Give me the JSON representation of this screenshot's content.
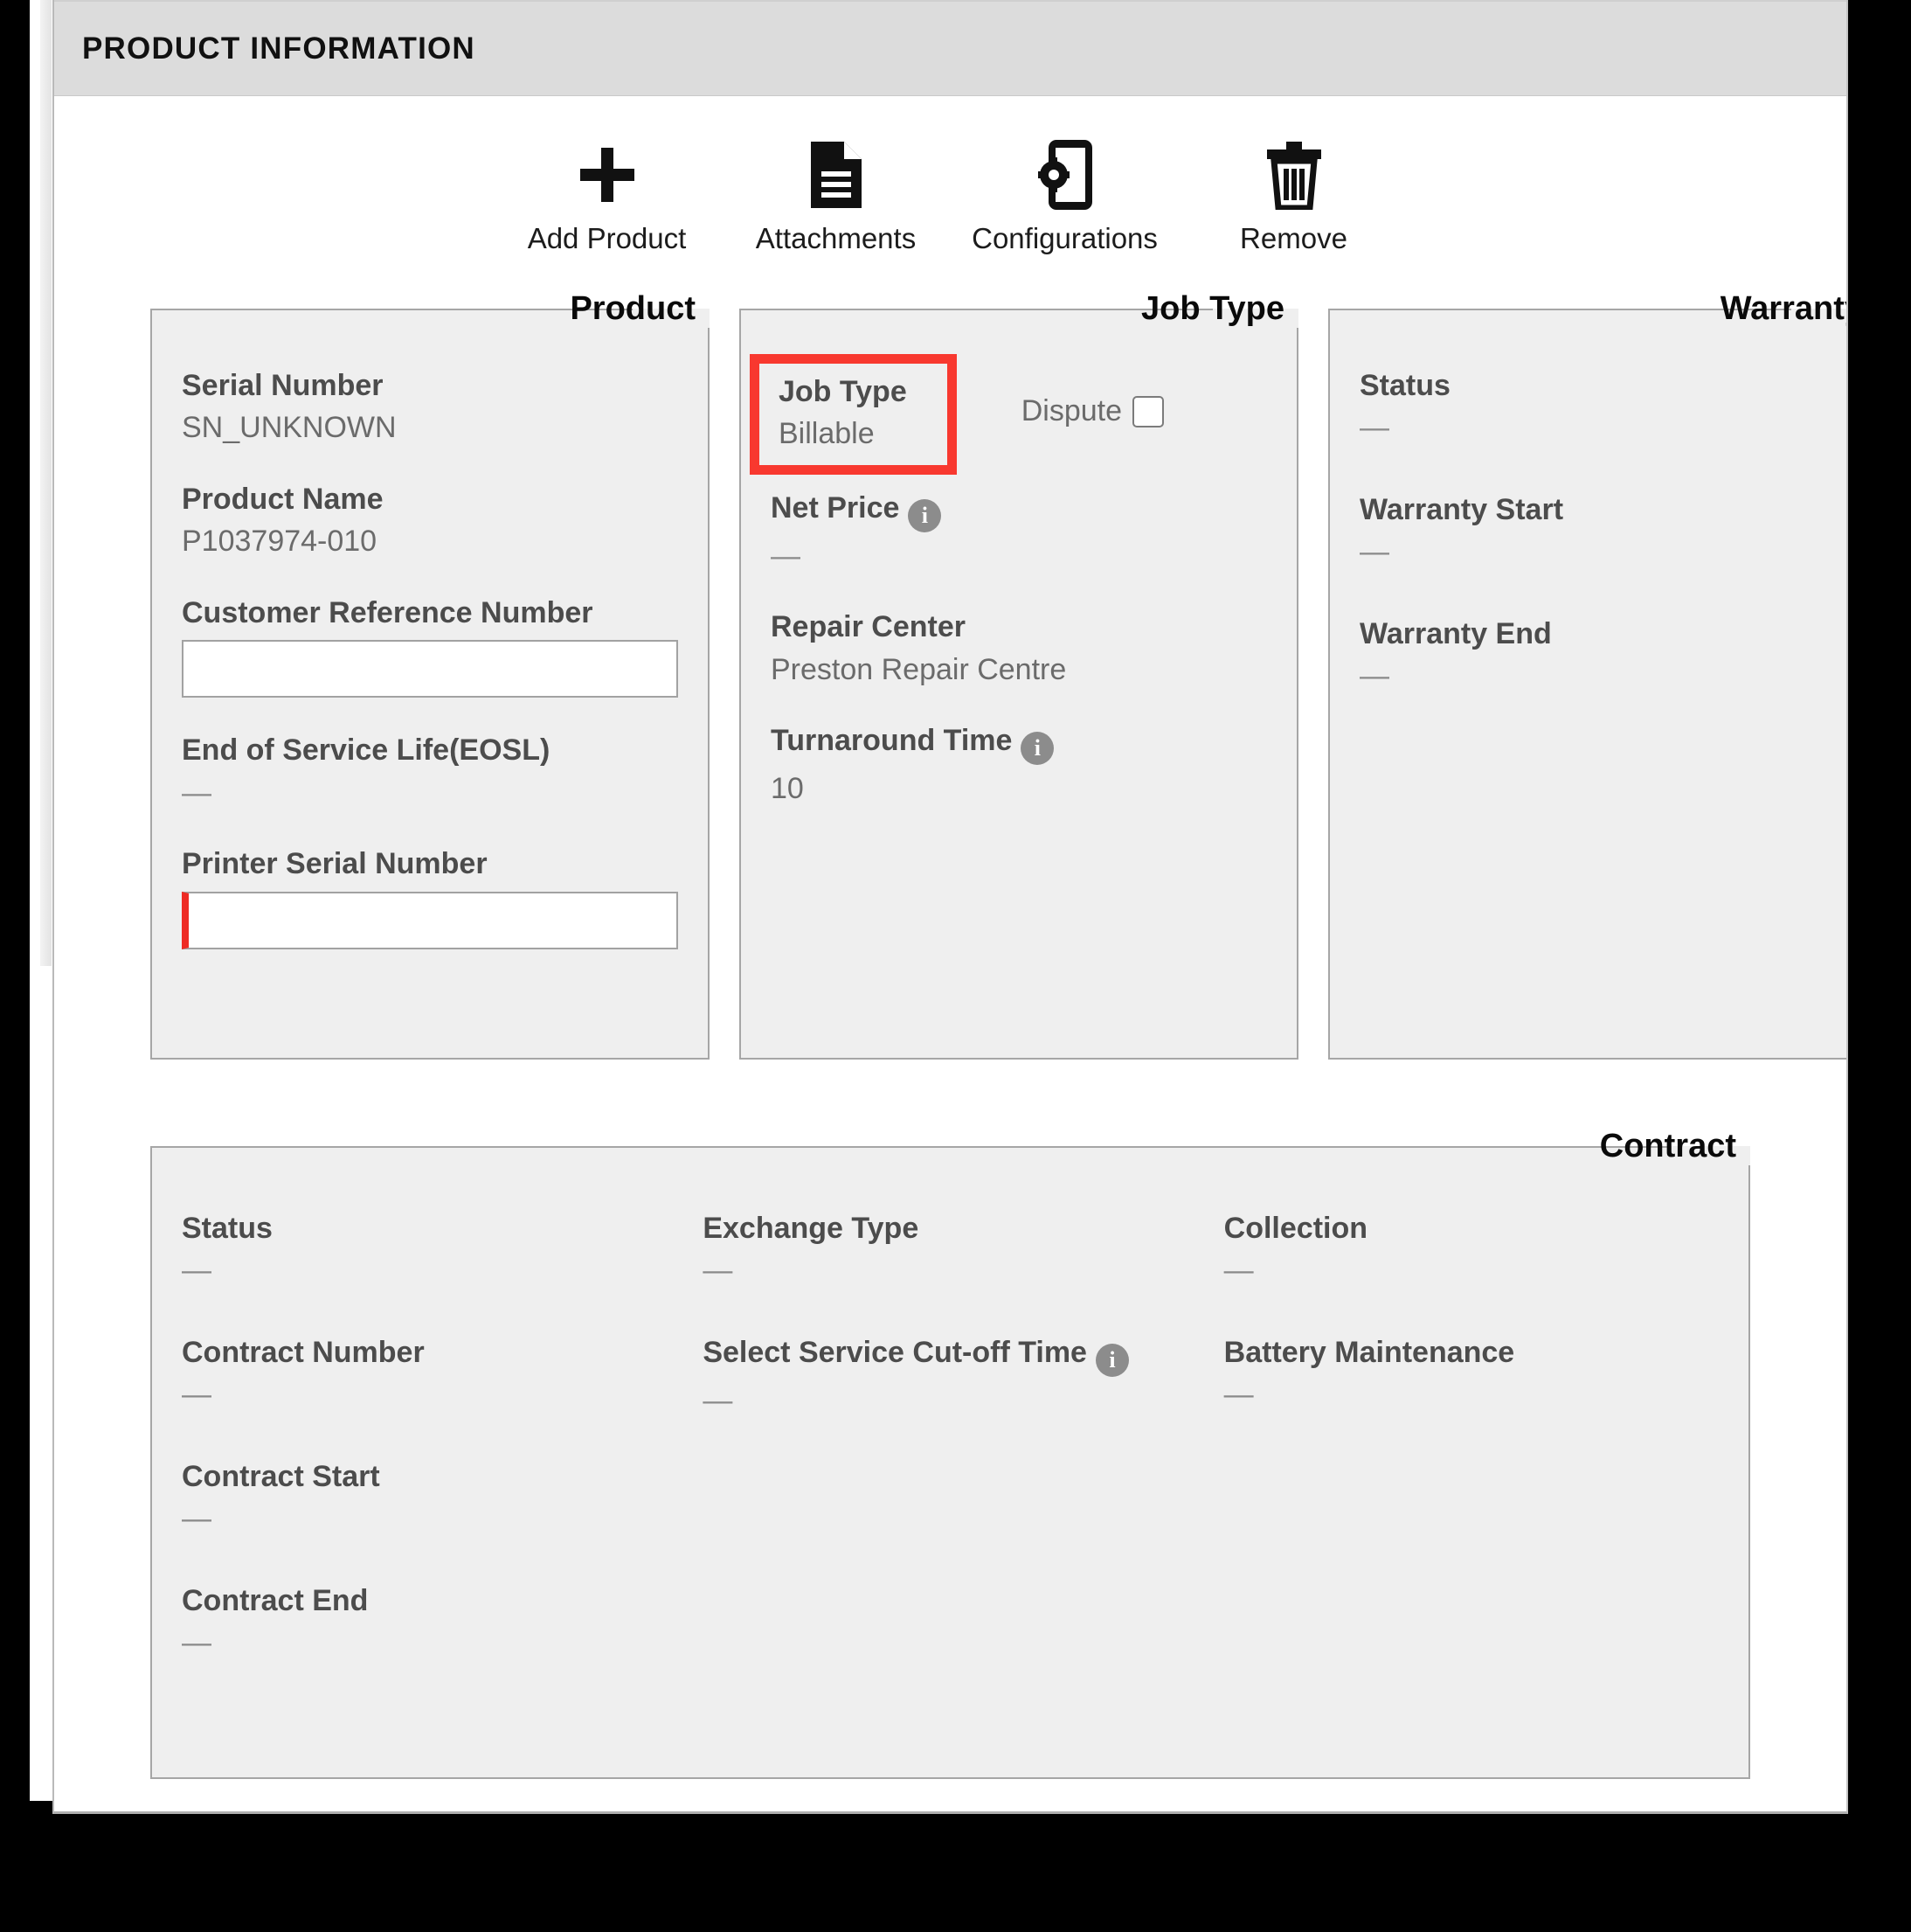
{
  "panel": {
    "title": "PRODUCT INFORMATION"
  },
  "toolbar": {
    "items": [
      {
        "label": "Add Product",
        "icon": "plus-icon"
      },
      {
        "label": "Attachments",
        "icon": "document-icon"
      },
      {
        "label": "Configurations",
        "icon": "device-gear-icon"
      },
      {
        "label": "Remove",
        "icon": "trash-icon"
      }
    ]
  },
  "product": {
    "legend": "Product",
    "serial_number_label": "Serial Number",
    "serial_number_value": "SN_UNKNOWN",
    "product_name_label": "Product Name",
    "product_name_value": "P1037974-010",
    "customer_reference_label": "Customer Reference Number",
    "customer_reference_value": "",
    "customer_reference_placeholder": "",
    "eosl_label": "End of Service Life(EOSL)",
    "eosl_value": "—",
    "printer_serial_label": "Printer Serial Number",
    "printer_serial_value": "",
    "printer_serial_placeholder": ""
  },
  "job_type": {
    "legend": "Job Type",
    "job_type_label": "Job Type",
    "job_type_value": "Billable",
    "dispute_label": "Dispute",
    "dispute_checked": false,
    "net_price_label": "Net Price",
    "net_price_value": "—",
    "repair_center_label": "Repair Center",
    "repair_center_value": "Preston Repair Centre",
    "turnaround_time_label": "Turnaround Time",
    "turnaround_time_value": "10",
    "info_glyph": "i",
    "highlight_color": "#f8382f"
  },
  "warranty": {
    "legend": "Warranty",
    "status_label": "Status",
    "status_value": "—",
    "warranty_start_label": "Warranty Start",
    "warranty_start_value": "—",
    "warranty_end_label": "Warranty End",
    "warranty_end_value": "—"
  },
  "contract": {
    "legend": "Contract",
    "status_label": "Status",
    "status_value": "—",
    "contract_number_label": "Contract Number",
    "contract_number_value": "—",
    "contract_start_label": "Contract Start",
    "contract_start_value": "—",
    "contract_end_label": "Contract End",
    "contract_end_value": "—",
    "exchange_type_label": "Exchange Type",
    "exchange_type_value": "—",
    "cutoff_time_label": "Select Service Cut-off Time",
    "cutoff_time_value": "—",
    "collection_label": "Collection",
    "collection_value": "—",
    "battery_maintenance_label": "Battery Maintenance",
    "battery_maintenance_value": "—"
  },
  "colors": {
    "header_bg": "#dcdcdc",
    "panel_bg": "#efefef",
    "label_text": "#4c4c4c",
    "value_text": "#6b6b6b",
    "required_marker": "#ee2b24",
    "annotation_red": "#f8382f",
    "info_icon_bg": "#8c8c8c"
  }
}
